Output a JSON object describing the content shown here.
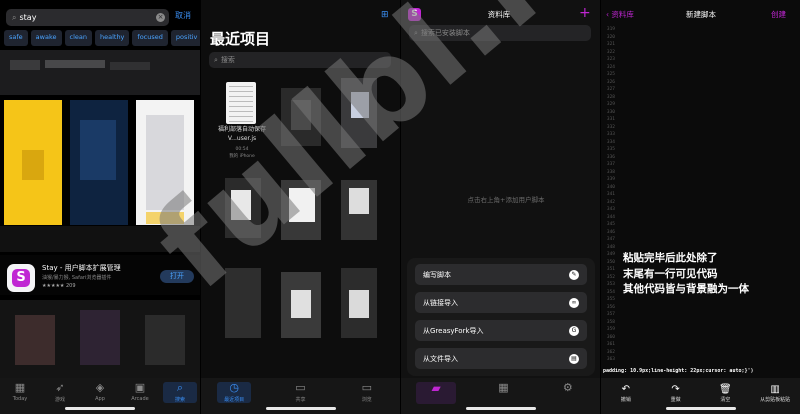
{
  "appstore": {
    "search_value": "stay",
    "cancel_label": "取消",
    "chips": [
      "safe",
      "awake",
      "clean",
      "healthy",
      "focused",
      "positiv"
    ],
    "app_title": "Stay - 用户脚本扩展管理",
    "app_sub": "油猴/暴力猴, Safari浏览器插件",
    "rating": "★★★★★ 209",
    "open_label": "打开",
    "tabs": [
      {
        "label": "Today",
        "icon": "today-icon"
      },
      {
        "label": "游戏",
        "icon": "rocket-icon"
      },
      {
        "label": "App",
        "icon": "layers-icon"
      },
      {
        "label": "Arcade",
        "icon": "arcade-icon"
      },
      {
        "label": "搜索",
        "icon": "search-icon"
      }
    ]
  },
  "files": {
    "title": "最近项目",
    "search_placeholder": "搜索",
    "file_name": "福利部落自动保存 V...user.js",
    "file_time": "00:54",
    "file_location": "我的 iPhone",
    "tabs": [
      {
        "label": "最近项目",
        "icon": "clock-icon"
      },
      {
        "label": "共享",
        "icon": "folder-shared-icon"
      },
      {
        "label": "浏览",
        "icon": "folder-icon"
      }
    ]
  },
  "library": {
    "title": "资料库",
    "search_placeholder": "搜索已安装脚本",
    "hint": "点击右上角+添加用户脚本",
    "actions": [
      {
        "label": "编写脚本",
        "icon": "pencil-icon"
      },
      {
        "label": "从链接导入",
        "icon": "link-icon"
      },
      {
        "label": "从GreasyFork导入",
        "icon": "greasyfork-icon"
      },
      {
        "label": "从文件导入",
        "icon": "file-icon"
      }
    ]
  },
  "editor": {
    "back_label": "资料库",
    "title": "新建脚本",
    "create_label": "创建",
    "line_start": 319,
    "line_end": 363,
    "note_lines": [
      "粘贴完毕后此处除了",
      "末尾有一行可见代码",
      "其他代码皆与背景融为一体"
    ],
    "code_line": "padding: 10.9px;line-height: 22px;cursor: auto;}')",
    "tools": [
      {
        "label": "撤销",
        "icon": "undo-icon"
      },
      {
        "label": "重做",
        "icon": "redo-icon"
      },
      {
        "label": "清空",
        "icon": "trash-icon"
      },
      {
        "label": "从剪贴板粘贴",
        "icon": "paste-icon"
      }
    ]
  },
  "watermark": "fullbl.net"
}
